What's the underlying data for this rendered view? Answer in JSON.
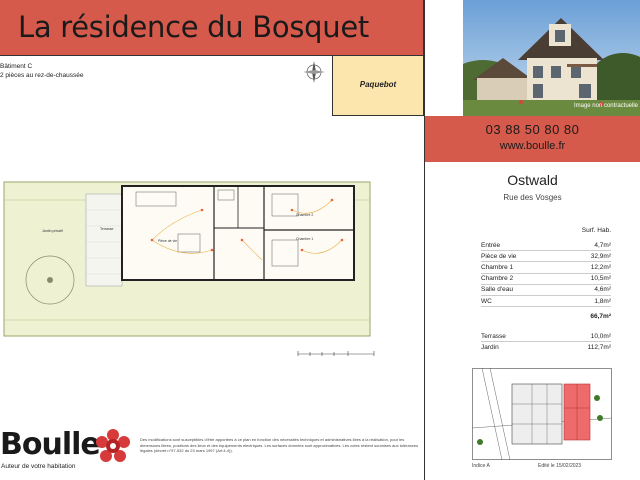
{
  "title": "La résidence du Bosquet",
  "building": {
    "batiment": "Bâtiment C",
    "description": "2 pièces au rez-de-chaussée",
    "type": "Paquebot"
  },
  "contact": {
    "phone": "03 88 50 80 80",
    "website": "www.boulle.fr"
  },
  "photo_caption": "Image non contractuelle",
  "location": {
    "city": "Ostwald",
    "street": "Rue des Vosges"
  },
  "surfaces": {
    "header": "Surf. Hab.",
    "rooms": [
      {
        "name": "Entrée",
        "value": "4,7m²"
      },
      {
        "name": "Pièce de vie",
        "value": "32,9m²"
      },
      {
        "name": "Chambre 1",
        "value": "12,2m²"
      },
      {
        "name": "Chambre 2",
        "value": "10,5m²"
      },
      {
        "name": "Salle d'eau",
        "value": "4,6m²"
      },
      {
        "name": "WC",
        "value": "1,8m²"
      }
    ],
    "total": "66,7m²",
    "extras": [
      {
        "name": "Terrasse",
        "value": "10,0m²"
      },
      {
        "name": "Jardin",
        "value": "112,7m²"
      }
    ]
  },
  "plan_labels": {
    "terrasse": "Terrasse",
    "jardin": "Jardin privatif",
    "piece_de_vie": "Pièce de vie",
    "chambre1": "Chambre 1",
    "chambre2": "Chambre 2"
  },
  "brand": {
    "name": "Boulle",
    "tagline": "Auteur de votre habitation"
  },
  "legal_text": "Des modifications sont susceptibles d'être apportées à ce plan en fonction des nécessités techniques et administratives liées à la réalisation, pour les dimensions libres, positions des lieux et des équipements électriques. Les surfaces données sont approximatives. Les cotes restent soumises aux tolérances légales (décret n°97-532 du 23 mars 1997 (Art.4.4)).",
  "footer": {
    "index": "Indice A",
    "edited": "Edité le 15/02/2023"
  },
  "colors": {
    "accent": "#d65a4b",
    "type_box": "#fde6ad",
    "garden": "#eef2d2",
    "highlight": "#ee6b6b"
  }
}
